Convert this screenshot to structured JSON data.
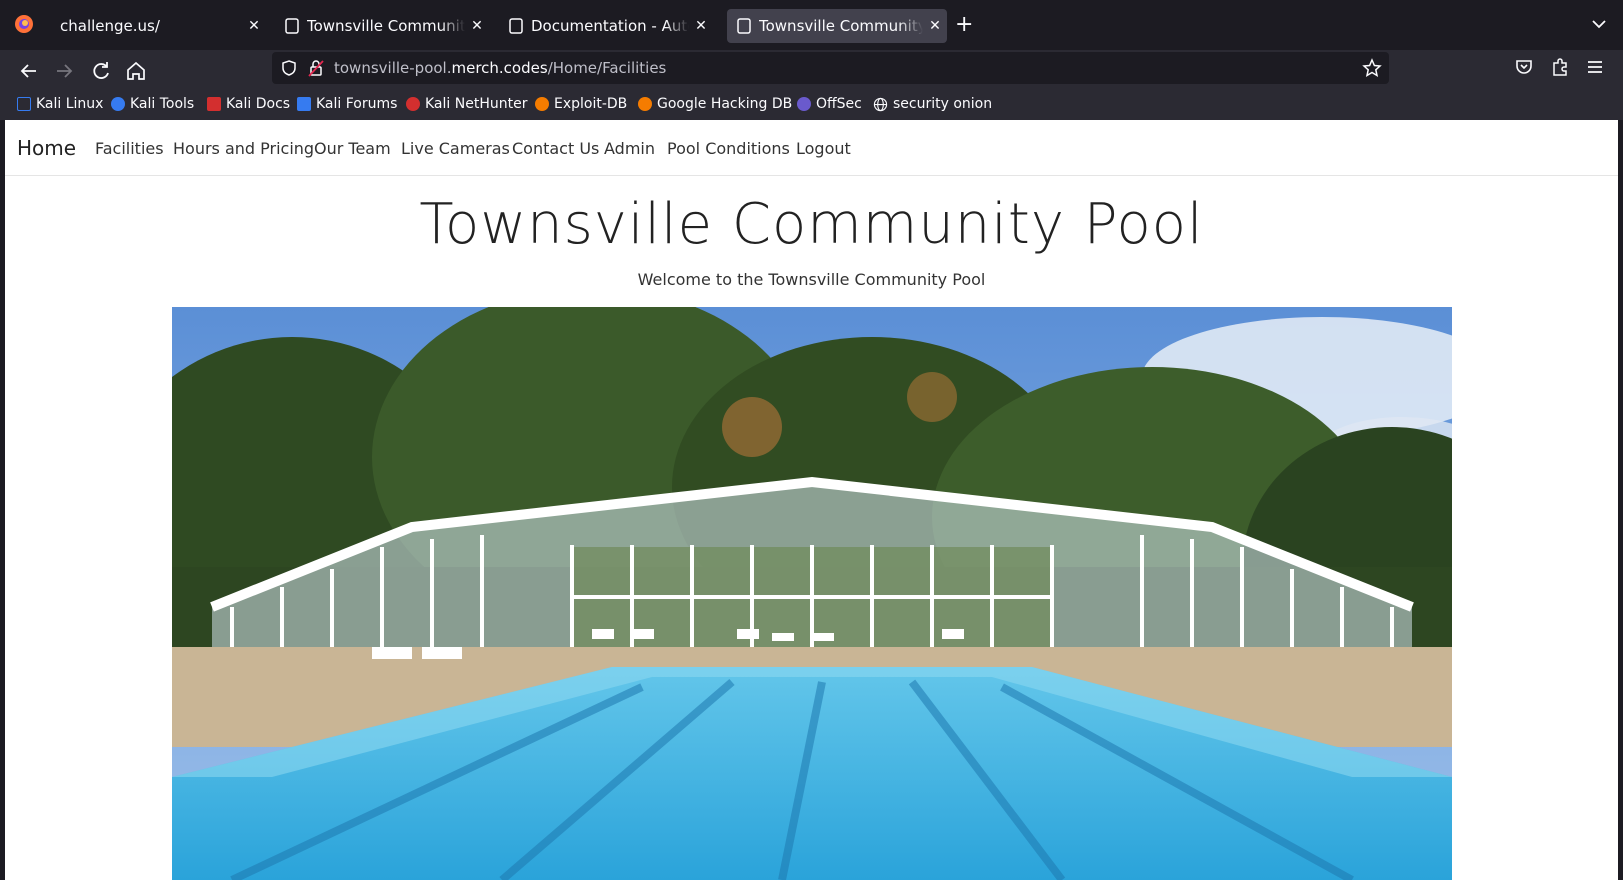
{
  "browser": {
    "tabs": [
      {
        "title": "challenge.us/",
        "active": false
      },
      {
        "title": "Townsville Community Pool",
        "active": false
      },
      {
        "title": "Documentation - Automation",
        "active": false
      },
      {
        "title": "Townsville Community Pool",
        "active": true
      }
    ],
    "url": {
      "prefix": "townsville-pool.",
      "domain": "merch.codes",
      "path": "/Home/Facilities"
    },
    "bookmarks": [
      {
        "label": "Kali Linux",
        "color": "#367bf0"
      },
      {
        "label": "Kali Tools",
        "color": "#367bf0"
      },
      {
        "label": "Kali Docs",
        "color": "#d32f2f"
      },
      {
        "label": "Kali Forums",
        "color": "#367bf0"
      },
      {
        "label": "Kali NetHunter",
        "color": "#d32f2f"
      },
      {
        "label": "Exploit-DB",
        "color": "#f57c00"
      },
      {
        "label": "Google Hacking DB",
        "color": "#f57c00"
      },
      {
        "label": "OffSec",
        "color": "#6a5acd"
      },
      {
        "label": "security onion",
        "color": "#cccccc"
      }
    ]
  },
  "site": {
    "brand": "Home",
    "nav": [
      "Facilities",
      "Hours and Pricing",
      "Our Team",
      "Live Cameras",
      "Contact Us",
      "Admin",
      "Pool Conditions",
      "Logout"
    ],
    "title": "Townsville Community Pool",
    "subtitle": "Welcome to the Townsville Community Pool"
  }
}
